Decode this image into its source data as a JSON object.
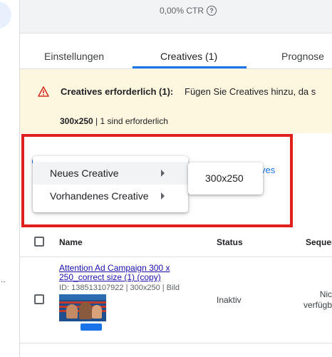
{
  "stats": {
    "ctr": "0,00% CTR",
    "help_icon": "help-circle-icon"
  },
  "tabs": [
    {
      "label": "Einstellungen"
    },
    {
      "label": "Creatives (1)"
    },
    {
      "label": "Prognose"
    }
  ],
  "warning": {
    "icon": "warning-triangle-icon",
    "title": "Creatives erforderlich (1):",
    "text": "Fügen Sie Creatives hinzu, da s",
    "size": "300x250",
    "size_note": "1 sind erforderlich"
  },
  "background_link": "ves",
  "menu": {
    "items": [
      {
        "label": "Neues Creative"
      },
      {
        "label": "Vorhandenes Creative"
      }
    ],
    "submenu": {
      "items": [
        {
          "label": "300x250"
        }
      ]
    }
  },
  "table": {
    "headers": {
      "name": "Name",
      "status": "Status",
      "sequence": "Sequer"
    },
    "rows": [
      {
        "name": "Attention Ad Campaign 300 x 250_correct size (1) (copy)",
        "meta": "ID: 138513107922 | 300x250 | Bild",
        "status": "Inaktiv",
        "availability_line1": "Nich",
        "availability_line2": "verfügba"
      }
    ]
  },
  "colors": {
    "accent": "#1a73e8",
    "warning_bg": "#fef7e0",
    "highlight": "#e0201d",
    "warning_icon": "#d93025"
  }
}
